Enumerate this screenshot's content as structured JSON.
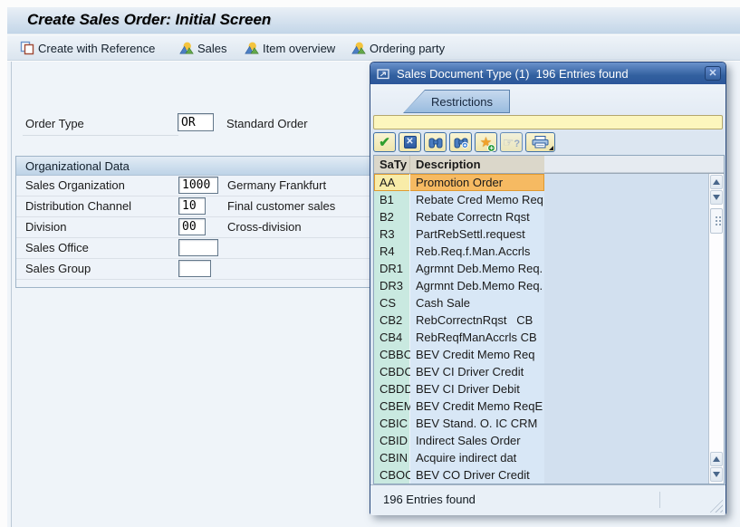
{
  "window": {
    "title": "Create Sales Order: Initial Screen"
  },
  "app_toolbar": {
    "buttons": [
      {
        "label": "Create with Reference",
        "icon": "copy-reference-icon"
      },
      {
        "label": "Sales",
        "icon": "mountain-sun-icon"
      },
      {
        "label": "Item overview",
        "icon": "mountain-sun-icon"
      },
      {
        "label": "Ordering party",
        "icon": "mountain-sun-icon"
      }
    ]
  },
  "form": {
    "order_type": {
      "label": "Order Type",
      "value": "OR",
      "description": "Standard Order"
    },
    "org_data": {
      "title": "Organizational Data",
      "rows": [
        {
          "label": "Sales Organization",
          "value": "1000",
          "description": "Germany Frankfurt"
        },
        {
          "label": "Distribution Channel",
          "value": "10",
          "description": "Final customer sales"
        },
        {
          "label": "Division",
          "value": "00",
          "description": "Cross-division"
        },
        {
          "label": "Sales Office",
          "value": "",
          "description": ""
        },
        {
          "label": "Sales Group",
          "value": "",
          "description": ""
        }
      ]
    }
  },
  "popup": {
    "title": "Sales Document Type (1)  196 Entries found",
    "close_icon": "close-x-icon",
    "tabs": [
      {
        "label": "Restrictions"
      }
    ],
    "search": {
      "value": ""
    },
    "toolbar_icons": [
      "continue-check-icon",
      "cancel-x-icon",
      "binoculars-find-icon",
      "binoculars-find-next-icon",
      "star-add-favorites-icon",
      "hand-help-icon",
      "printer-icon",
      "print-dropdown-caret-icon"
    ],
    "table": {
      "columns": [
        "SaTy",
        "Description"
      ],
      "selected_index": 0,
      "rows": [
        {
          "saty": "AA",
          "description": "Promotion Order"
        },
        {
          "saty": "B1",
          "description": "Rebate Cred Memo Req"
        },
        {
          "saty": "B2",
          "description": "Rebate Correctn Rqst"
        },
        {
          "saty": "R3",
          "description": "PartRebSettl.request"
        },
        {
          "saty": "R4",
          "description": "Reb.Req.f.Man.Accrls"
        },
        {
          "saty": "DR1",
          "description": "Agrmnt Deb.Memo Req."
        },
        {
          "saty": "DR3",
          "description": "Agrmnt Deb.Memo Req."
        },
        {
          "saty": "CS",
          "description": "Cash Sale"
        },
        {
          "saty": "CB2",
          "description": "RebCorrectnRqst   CB"
        },
        {
          "saty": "CB4",
          "description": "RebReqfManAccrls CB"
        },
        {
          "saty": "CBBO",
          "description": "BEV Credit Memo Req"
        },
        {
          "saty": "CBDC",
          "description": "BEV CI Driver Credit"
        },
        {
          "saty": "CBDD",
          "description": "BEV CI Driver Debit"
        },
        {
          "saty": "CBEM",
          "description": "BEV Credit Memo ReqE"
        },
        {
          "saty": "CBIC",
          "description": "BEV Stand. O. IC CRM"
        },
        {
          "saty": "CBID",
          "description": "Indirect Sales Order"
        },
        {
          "saty": "CBIN",
          "description": "Acquire indirect dat"
        },
        {
          "saty": "CBOC",
          "description": "BEV CO Driver Credit"
        }
      ]
    },
    "status": "196 Entries found"
  },
  "colors": {
    "popup_titlebar": "#33609f",
    "selected_row": "#f6ba62",
    "selected_row_key": "#f8eca8",
    "row_key_bg": "#c9e9e0",
    "row_desc_bg": "#d8e7f6",
    "table_header_bg": "#dbd7ca",
    "search_bar_bg": "#fcf6bd"
  }
}
